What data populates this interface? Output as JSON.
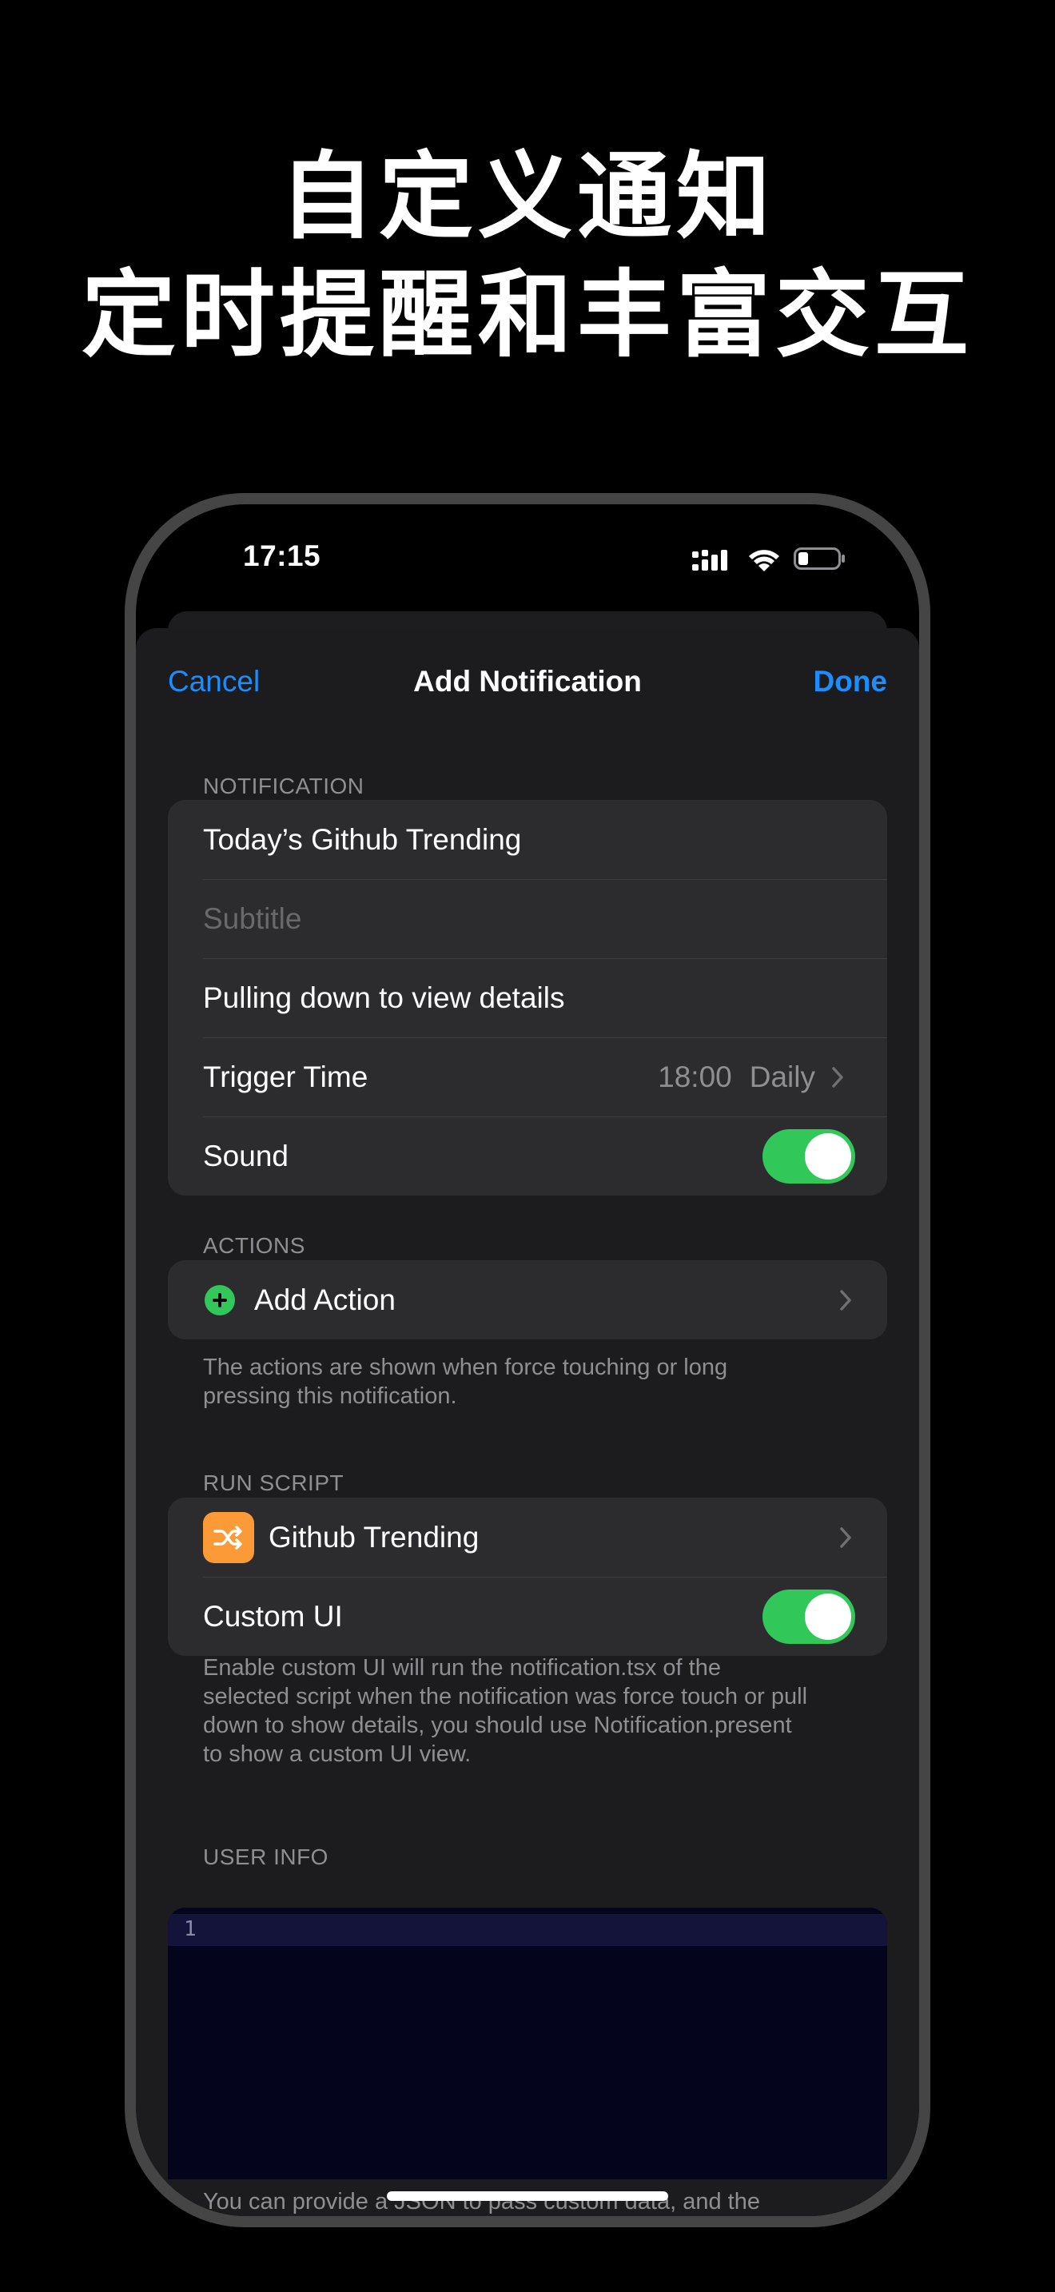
{
  "promo": {
    "line1": "自定义通知",
    "line2": "定时提醒和丰富交互"
  },
  "status_bar": {
    "time": "17:15"
  },
  "nav": {
    "cancel": "Cancel",
    "title": "Add Notification",
    "done": "Done"
  },
  "notification": {
    "header": "NOTIFICATION",
    "title_value": "Today’s Github Trending",
    "subtitle_placeholder": "Subtitle",
    "body_value": "Pulling down to view details",
    "trigger_label": "Trigger Time",
    "trigger_time": "18:00",
    "trigger_repeat": "Daily",
    "sound_label": "Sound",
    "sound_on": true
  },
  "actions": {
    "header": "ACTIONS",
    "add_label": "Add Action",
    "footnote": "The actions are shown when force touching or long pressing this notification."
  },
  "run_script": {
    "header": "RUN SCRIPT",
    "script_name": "Github Trending",
    "custom_ui_label": "Custom UI",
    "custom_ui_on": true,
    "footnote": "Enable custom UI will run the notification.tsx of the selected script when the notification was force touch or pull down to show details, you should use Notification.present to show a custom UI view."
  },
  "user_info": {
    "header": "USER INFO",
    "line_number": "1",
    "footnote": "You can provide a JSON to pass custom data, and the"
  },
  "colors": {
    "accent": "#1c8dfc",
    "toggle_on": "#31c859",
    "script_icon": "#fd9a38",
    "cell_bg": "#2c2c2e",
    "sheet_bg": "#1c1c1e"
  }
}
